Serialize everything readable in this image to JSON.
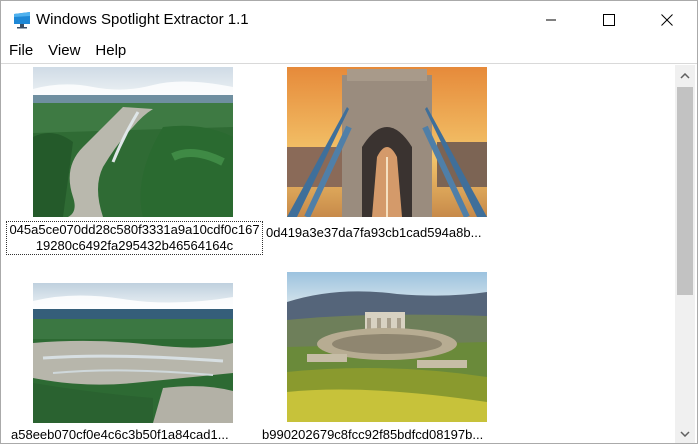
{
  "window": {
    "title": "Windows Spotlight Extractor 1.1",
    "icon": "monitor-app-icon"
  },
  "controls": {
    "minimize_icon": "minimize-icon",
    "maximize_icon": "maximize-icon",
    "close_icon": "close-icon"
  },
  "menu": {
    "items": [
      "File",
      "View",
      "Help"
    ]
  },
  "images": [
    {
      "caption": "045a5ce070dd28c580f3331a9a10cdf0c16719280c6492fa295432b46564164c",
      "scene": "aerial river valley with forest",
      "selected": true
    },
    {
      "caption": "0d419a3e37da7fa93cb1cad594a8b...",
      "scene": "suspension bridge tower at sunset",
      "selected": false
    },
    {
      "caption": "a58eeb070cf0e4c6c3b50f1a84cad1...",
      "scene": "aerial river delta with forest",
      "selected": false
    },
    {
      "caption": "b990202679c8fcc92f85bdfcd08197b...",
      "scene": "ancient ruins on grassy hillside",
      "selected": false
    }
  ],
  "scrollbar": {
    "up_icon": "scroll-up-icon",
    "down_icon": "scroll-down-icon",
    "thumb_color": "#c2c2c2",
    "track_color": "#f0f0f0"
  }
}
